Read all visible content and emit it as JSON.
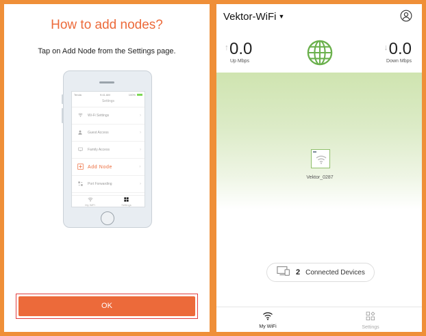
{
  "help": {
    "title": "How to add nodes?",
    "subtitle": "Tap on Add Node from the Settings page.",
    "ok_label": "OK",
    "phone": {
      "status_left": "Tenda",
      "status_time": "9:41 AM",
      "status_battery": "100%",
      "screen_title": "Settings",
      "menu": [
        {
          "label": "Wi-Fi Settings",
          "icon": "wifi-icon"
        },
        {
          "label": "Guest Access",
          "icon": "guest-icon"
        },
        {
          "label": "Family Access",
          "icon": "family-icon"
        },
        {
          "label": "Add Node",
          "icon": "add-node-icon"
        },
        {
          "label": "Port Forwarding",
          "icon": "port-forwarding-icon"
        }
      ],
      "tabs": [
        {
          "label": "My WiFi",
          "icon": "wifi-icon"
        },
        {
          "label": "Settings",
          "icon": "grid-icon"
        }
      ]
    }
  },
  "main": {
    "network_name": "Vektor-WiFi",
    "up": {
      "value": "0.0",
      "unit": "Up Mbps"
    },
    "down": {
      "value": "0.0",
      "unit": "Down Mbps"
    },
    "node_name": "Vektor_0287",
    "connected_count": "2",
    "connected_label": "Connected Devices",
    "tabs": [
      {
        "label": "My WiFi",
        "icon": "wifi-icon"
      },
      {
        "label": "Settings",
        "icon": "settings-grid-icon"
      }
    ]
  },
  "colors": {
    "frame": "#ef8f38",
    "accent": "#ec6a3a",
    "highlight_outline": "#e23b3b",
    "globe": "#6ab04c"
  }
}
